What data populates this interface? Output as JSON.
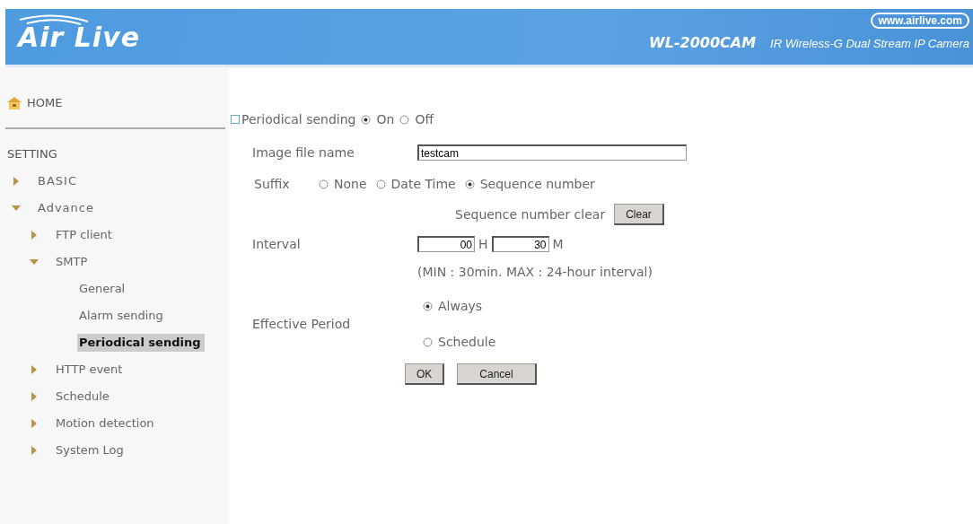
{
  "header": {
    "logo": "Air Live",
    "website": "www.airlive.com",
    "model": "WL-2000CAM",
    "product": "IR Wireless-G Dual Stream IP Camera"
  },
  "sidebar": {
    "home": "HOME",
    "section": "SETTING",
    "items": [
      {
        "label": "BASIC",
        "expanded": false,
        "selected": false
      },
      {
        "label": "Advance",
        "expanded": true,
        "selected": false,
        "children": [
          {
            "label": "FTP client",
            "expanded": false,
            "selected": false
          },
          {
            "label": "SMTP",
            "expanded": true,
            "selected": false,
            "children": [
              {
                "label": "General",
                "selected": false
              },
              {
                "label": "Alarm sending",
                "selected": false
              },
              {
                "label": "Periodical sending",
                "selected": true
              }
            ]
          },
          {
            "label": "HTTP event",
            "expanded": false,
            "selected": false
          },
          {
            "label": "Schedule",
            "expanded": false,
            "selected": false
          },
          {
            "label": "Motion detection",
            "expanded": false,
            "selected": false
          },
          {
            "label": "System Log",
            "expanded": false,
            "selected": false
          }
        ]
      }
    ]
  },
  "form": {
    "title": "Periodical sending",
    "switch": [
      {
        "label": "On",
        "selected": true
      },
      {
        "label": "Off",
        "selected": false
      }
    ],
    "file_name": {
      "label": "Image file name",
      "value": "testcam"
    },
    "suffix": {
      "label": "Suffix",
      "options": [
        {
          "label": "None",
          "selected": false
        },
        {
          "label": "Date Time",
          "selected": false
        },
        {
          "label": "Sequence number",
          "selected": true
        }
      ]
    },
    "sequence_clear": {
      "label": "Sequence number clear",
      "button": "Clear"
    },
    "interval": {
      "label": "Interval",
      "hours": "00",
      "hours_unit": "H",
      "minutes": "30",
      "minutes_unit": "M",
      "note": "(MIN : 30min. MAX : 24-hour interval)"
    },
    "effective_period": {
      "label": "Effective Period",
      "options": [
        {
          "label": "Always",
          "selected": true
        },
        {
          "label": "Schedule",
          "selected": false
        }
      ]
    },
    "buttons": [
      "OK",
      "Cancel"
    ]
  }
}
